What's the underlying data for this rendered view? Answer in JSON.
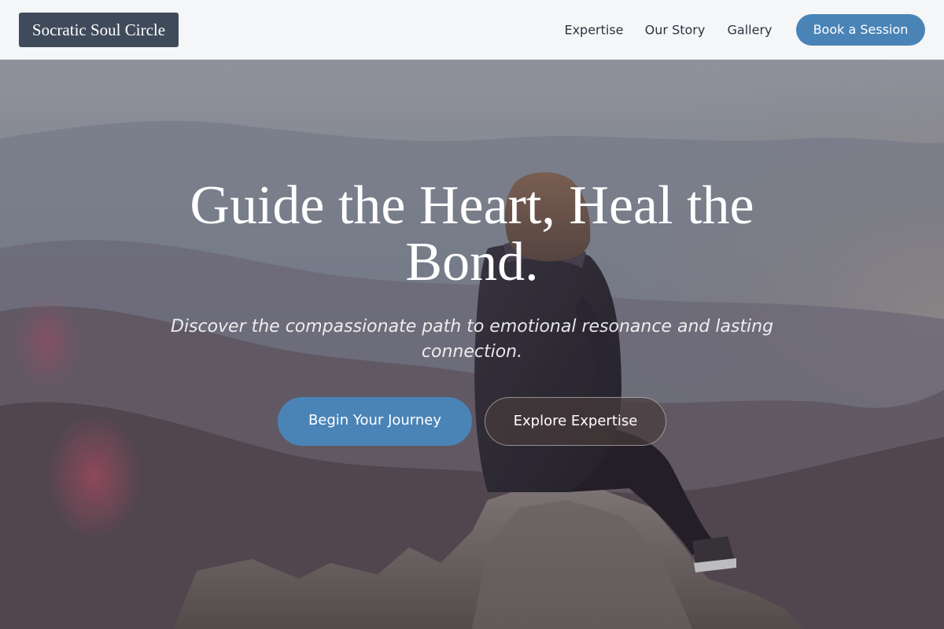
{
  "header": {
    "logo_text": "Socratic Soul Circle",
    "nav": {
      "expertise": "Expertise",
      "our_story": "Our Story",
      "gallery": "Gallery"
    },
    "book_label": "Book a Session"
  },
  "hero": {
    "headline": "Guide the Heart, Heal the Bond.",
    "subtitle": "Discover the compassionate path to emotional resonance and lasting connection.",
    "primary_cta": "Begin Your Journey",
    "secondary_cta": "Explore Expertise",
    "background_image": "person sitting on rocky summit overlooking misty mountains at sunset"
  },
  "colors": {
    "header_bg": "#f5f6f8",
    "logo_bg": "#3f4b5b",
    "accent": "#4a84b7",
    "nav_text": "#2c3440"
  }
}
